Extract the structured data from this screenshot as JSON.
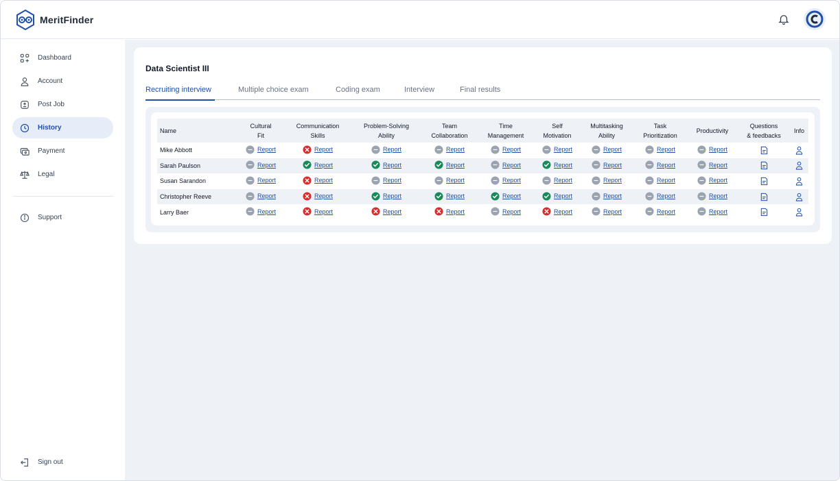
{
  "app": {
    "name": "MeritFinder"
  },
  "colors": {
    "accent": "#1f4fa6",
    "pass": "#1b8a5a",
    "fail": "#d62e2e",
    "neutral": "#9aa3af",
    "background": "#eef1f6"
  },
  "sidebar": {
    "items": [
      {
        "label": "Dashboard",
        "icon": "grid-icon"
      },
      {
        "label": "Account",
        "icon": "user-icon"
      },
      {
        "label": "Post Job",
        "icon": "post-job-icon"
      },
      {
        "label": "History",
        "icon": "clock-icon",
        "active": true
      },
      {
        "label": "Payment",
        "icon": "payment-icon"
      },
      {
        "label": "Legal",
        "icon": "scale-icon"
      }
    ],
    "support": "Support",
    "signout": "Sign out"
  },
  "page": {
    "title": "Data Scientist III",
    "tabs": [
      "Recruiting interview",
      "Multiple choice exam",
      "Coding exam",
      "Interview",
      "Final results"
    ]
  },
  "table": {
    "headers": {
      "name": "Name",
      "cultural": [
        "Cultural",
        "Fit"
      ],
      "communication": [
        "Communication",
        "Skills"
      ],
      "problem": [
        "Problem-Solving",
        "Ability"
      ],
      "team": [
        "Team",
        "Collaboration"
      ],
      "time": [
        "Time",
        "Management"
      ],
      "self": [
        "Self",
        "Motivation"
      ],
      "multitask": [
        "Multitasking",
        "Ability"
      ],
      "task": [
        "Task",
        "Prioritization"
      ],
      "productivity": "Productivity",
      "questions": [
        "Questions",
        "& feedbacks"
      ],
      "info": "Info"
    },
    "report_label": "Report",
    "rows": [
      {
        "name": "Mike Abbott",
        "statuses": [
          "neutral",
          "fail",
          "neutral",
          "neutral",
          "neutral",
          "neutral",
          "neutral",
          "neutral",
          "neutral"
        ]
      },
      {
        "name": "Sarah Paulson",
        "statuses": [
          "neutral",
          "pass",
          "pass",
          "pass",
          "neutral",
          "pass",
          "neutral",
          "neutral",
          "neutral"
        ]
      },
      {
        "name": "Susan Sarandon",
        "statuses": [
          "neutral",
          "fail",
          "neutral",
          "neutral",
          "neutral",
          "neutral",
          "neutral",
          "neutral",
          "neutral"
        ]
      },
      {
        "name": "Christopher Reeve",
        "statuses": [
          "neutral",
          "fail",
          "pass",
          "pass",
          "pass",
          "pass",
          "neutral",
          "neutral",
          "neutral"
        ]
      },
      {
        "name": "Larry Baer",
        "statuses": [
          "neutral",
          "fail",
          "fail",
          "fail",
          "neutral",
          "fail",
          "neutral",
          "neutral",
          "neutral"
        ]
      }
    ]
  }
}
